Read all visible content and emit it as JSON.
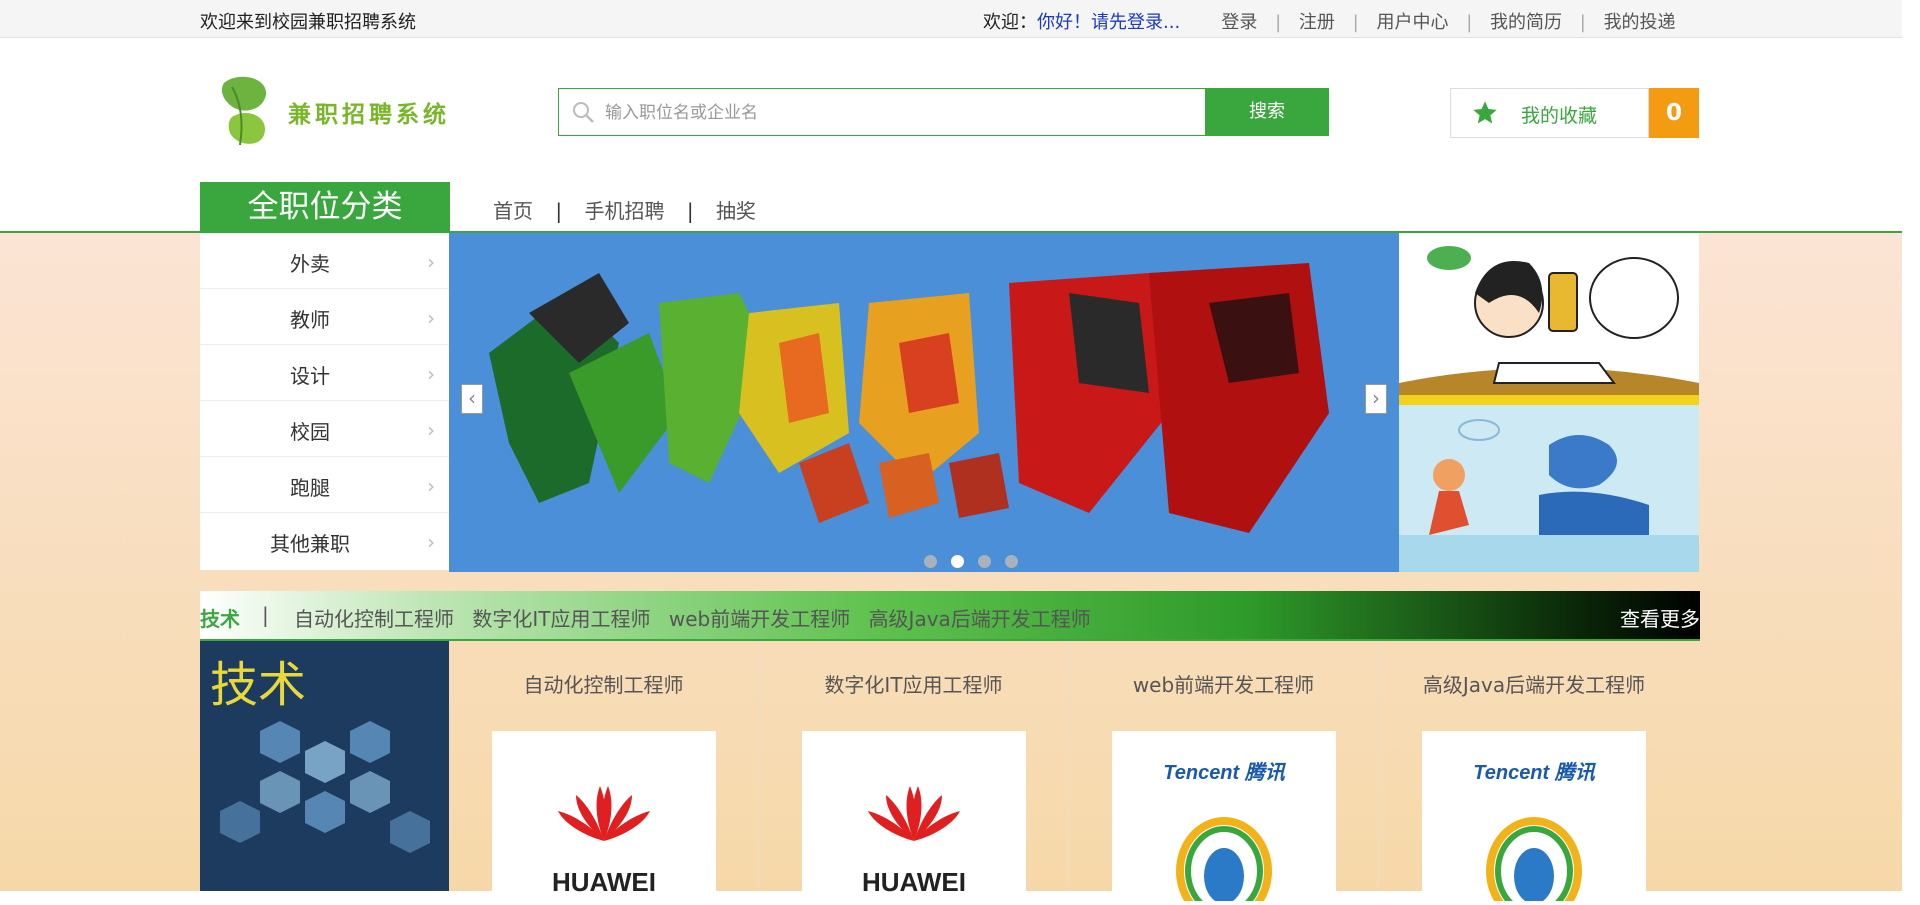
{
  "topbar": {
    "welcome": "欢迎来到校园兼职招聘系统",
    "greeting_label": "欢迎：",
    "greeting_user": "你好！请先登录...",
    "links": [
      "登录",
      "注册",
      "用户中心",
      "我的简历",
      "我的投递"
    ]
  },
  "header": {
    "logo_text": "兼职招聘系统",
    "search": {
      "placeholder": "输入职位名或企业名",
      "value": ""
    },
    "search_button": "搜索",
    "favorites_label": "我的收藏",
    "favorites_count": "0"
  },
  "nav": {
    "category_title": "全职位分类",
    "items": [
      "首页",
      "手机招聘",
      "抽奖"
    ]
  },
  "sidebar": {
    "categories": [
      "外卖",
      "教师",
      "设计",
      "校园",
      "跑腿",
      "其他兼职"
    ]
  },
  "banner": {
    "slide_count": 4,
    "active_slide": 1
  },
  "tech_section": {
    "label": "技术",
    "divider": "|",
    "links": [
      "自动化控制工程师",
      "数字化IT应用工程师",
      "web前端开发工程师",
      "高级Java后端开发工程师"
    ],
    "more": "查看更多",
    "image_text": "技术",
    "jobs": [
      {
        "title": "自动化控制工程师",
        "company_logo": "HUAWEI"
      },
      {
        "title": "数字化IT应用工程师",
        "company_logo": "HUAWEI"
      },
      {
        "title": "web前端开发工程师",
        "company_logo": "Tencent 腾讯"
      },
      {
        "title": "高级Java后端开发工程师",
        "company_logo": "Tencent 腾讯"
      }
    ]
  },
  "colors": {
    "brand_green": "#3aa73e",
    "accent_orange": "#f39c12",
    "link_blue": "#1a3ac0"
  }
}
